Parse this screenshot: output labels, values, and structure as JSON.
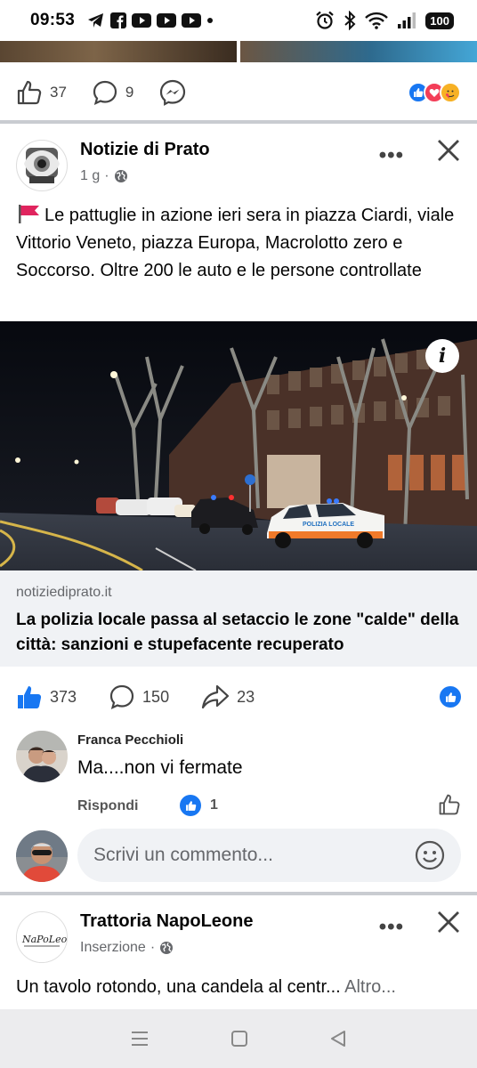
{
  "status": {
    "time": "09:53",
    "battery": "100"
  },
  "prev_post": {
    "likes": "37",
    "comments": "9"
  },
  "post": {
    "author": "Notizie di Prato",
    "age": "1 g",
    "text": "Le pattuglie in azione ieri sera in piazza Ciardi, viale Vittorio Veneto, piazza Europa, Macrolotto zero e Soccorso. Oltre 200 le auto e le persone controllate",
    "link_domain": "notiziediprato.it",
    "link_title": "La polizia locale passa al setaccio le zone \"calde\" della città: sanzioni e stupefacente recuperato",
    "likes": "373",
    "comments": "150",
    "shares": "23",
    "photo_car_text": "POLIZIA LOCALE",
    "colors": {
      "accent": "#1877f2",
      "flag": "#e0245e"
    }
  },
  "comment": {
    "author": "Franca Pecchioli",
    "text": "Ma....non vi fermate",
    "reply_label": "Rispondi",
    "likes": "1"
  },
  "composer": {
    "placeholder": "Scrivi un commento..."
  },
  "post2": {
    "author": "Trattoria NapoLeone",
    "sub": "Inserzione",
    "text": "Un tavolo rotondo, una candela al centr...",
    "more": "Altro...",
    "logo_text": "NaPoLeone"
  }
}
